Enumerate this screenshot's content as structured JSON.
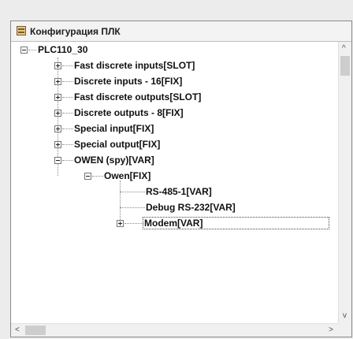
{
  "window": {
    "title": "Конфигурация ПЛК",
    "title_icon": "config-table-icon"
  },
  "tree": {
    "root": "PLC110_30",
    "items": [
      {
        "label": "Fast discrete inputs[SLOT]",
        "expander": "plus"
      },
      {
        "label": "Discrete inputs - 16[FIX]",
        "expander": "plus"
      },
      {
        "label": "Fast discrete outputs[SLOT]",
        "expander": "plus"
      },
      {
        "label": "Discrete outputs - 8[FIX]",
        "expander": "plus"
      },
      {
        "label": "Special input[FIX]",
        "expander": "plus"
      },
      {
        "label": "Special output[FIX]",
        "expander": "plus"
      },
      {
        "label": "OWEN (spy)[VAR]",
        "expander": "minus"
      }
    ],
    "owen": {
      "label": "Owen[FIX]",
      "children": [
        {
          "label": "RS-485-1[VAR]"
        },
        {
          "label": "Debug RS-232[VAR]"
        },
        {
          "label": "Modem[VAR]",
          "expander": "plus",
          "selected": true
        }
      ]
    }
  },
  "scrollbars": {
    "up": "^",
    "down": "v",
    "left": "<",
    "right": ">"
  }
}
